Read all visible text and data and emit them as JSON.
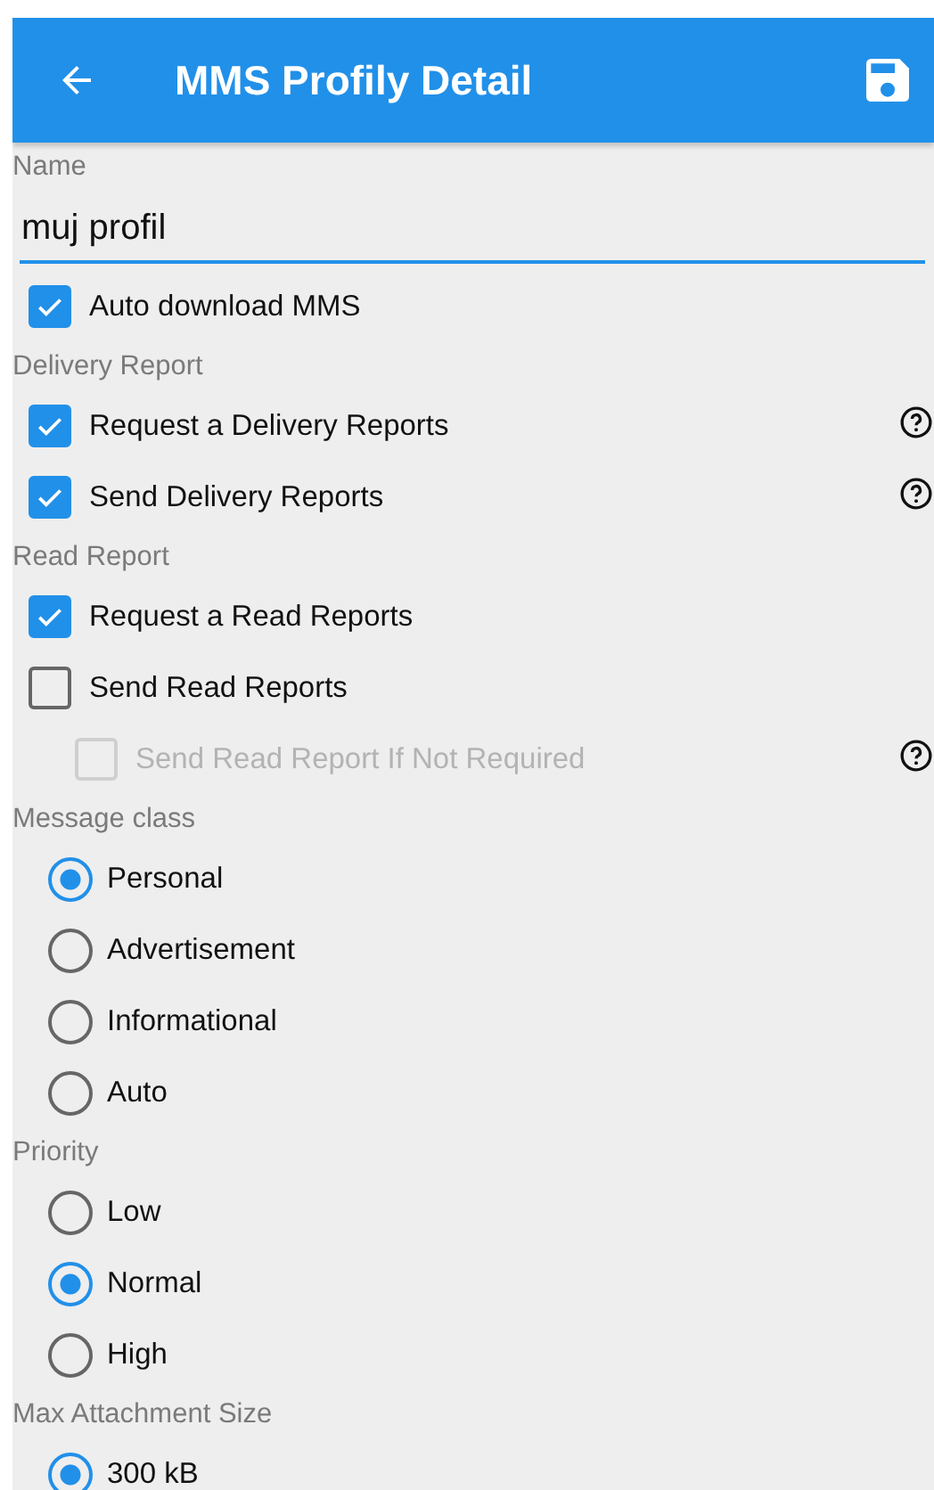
{
  "app_bar": {
    "title": "MMS Profily Detail"
  },
  "name_field": {
    "label": "Name",
    "value": "muj profil"
  },
  "sections": [
    {
      "items": [
        {
          "kind": "checkbox",
          "label": "Auto download MMS",
          "checked": true
        }
      ]
    },
    {
      "title": "Delivery Report",
      "items": [
        {
          "kind": "checkbox",
          "label": "Request a Delivery Reports",
          "checked": true,
          "help": true
        },
        {
          "kind": "checkbox",
          "label": "Send Delivery Reports",
          "checked": true,
          "help": true
        }
      ]
    },
    {
      "title": "Read Report",
      "items": [
        {
          "kind": "checkbox",
          "label": "Request a Read Reports",
          "checked": true
        },
        {
          "kind": "checkbox",
          "label": "Send Read Reports",
          "checked": false
        },
        {
          "kind": "checkbox",
          "label": "Send Read Report If Not Required",
          "checked": false,
          "help": true,
          "indented": true,
          "disabled": true
        }
      ]
    },
    {
      "title": "Message class",
      "items": [
        {
          "kind": "radio",
          "label": "Personal",
          "selected": true
        },
        {
          "kind": "radio",
          "label": "Advertisement",
          "selected": false
        },
        {
          "kind": "radio",
          "label": "Informational",
          "selected": false
        },
        {
          "kind": "radio",
          "label": "Auto",
          "selected": false
        }
      ]
    },
    {
      "title": "Priority",
      "items": [
        {
          "kind": "radio",
          "label": "Low",
          "selected": false
        },
        {
          "kind": "radio",
          "label": "Normal",
          "selected": true
        },
        {
          "kind": "radio",
          "label": "High",
          "selected": false
        }
      ]
    },
    {
      "title": "Max Attachment Size",
      "items": [
        {
          "kind": "radio",
          "label": "300 kB",
          "selected": true
        }
      ]
    }
  ]
}
